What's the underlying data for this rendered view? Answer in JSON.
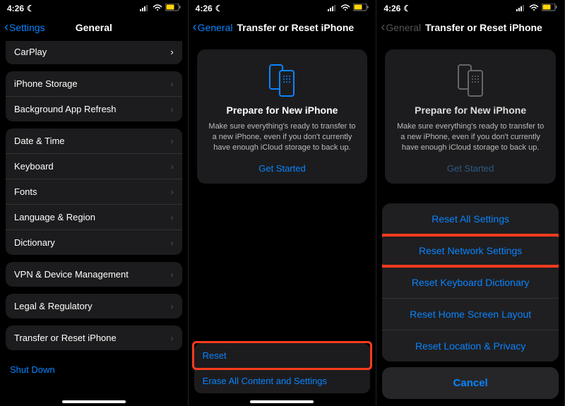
{
  "status": {
    "time": "4:26",
    "moon": "☾"
  },
  "panel1": {
    "back": "Settings",
    "title": "General",
    "partial": "CarPlay",
    "group1": [
      "iPhone Storage",
      "Background App Refresh"
    ],
    "group2": [
      "Date & Time",
      "Keyboard",
      "Fonts",
      "Language & Region",
      "Dictionary"
    ],
    "group3": [
      "VPN & Device Management"
    ],
    "group4": [
      "Legal & Regulatory"
    ],
    "group5": [
      "Transfer or Reset iPhone"
    ],
    "shutdown": "Shut Down"
  },
  "panel2": {
    "back": "General",
    "title": "Transfer or Reset iPhone",
    "card": {
      "heading": "Prepare for New iPhone",
      "body": "Make sure everything's ready to transfer to a new iPhone, even if you don't currently have enough iCloud storage to back up.",
      "cta": "Get Started"
    },
    "reset": "Reset",
    "erase": "Erase All Content and Settings"
  },
  "panel3": {
    "back": "General",
    "title": "Transfer or Reset iPhone",
    "card": {
      "heading": "Prepare for New iPhone",
      "body": "Make sure everything's ready to transfer to a new iPhone, even if you don't currently have enough iCloud storage to back up.",
      "cta": "Get Started"
    },
    "options": [
      "Reset All Settings",
      "Reset Network Settings",
      "Reset Keyboard Dictionary",
      "Reset Home Screen Layout",
      "Reset Location & Privacy"
    ],
    "cancel": "Cancel"
  }
}
